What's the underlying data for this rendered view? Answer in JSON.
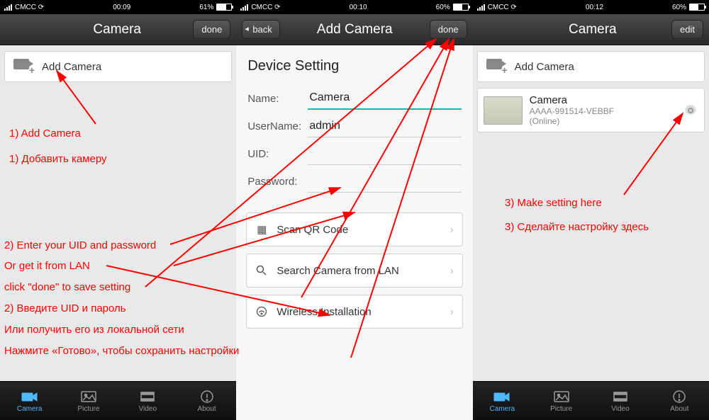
{
  "screen1": {
    "status": {
      "carrier": "CMCC",
      "time": "00:09",
      "battery_pct": "61%",
      "batt_fill": 61
    },
    "nav": {
      "title": "Camera",
      "done": "done"
    },
    "addCamera": {
      "label": "Add Camera"
    },
    "tabs": {
      "camera": "Camera",
      "picture": "Picture",
      "video": "Video",
      "about": "About"
    }
  },
  "screen2": {
    "status": {
      "carrier": "CMCC",
      "time": "00:10",
      "battery_pct": "60%",
      "batt_fill": 60
    },
    "nav": {
      "back": "back",
      "title": "Add Camera",
      "done": "done"
    },
    "section": "Device Setting",
    "fields": {
      "name_label": "Name:",
      "name_value": "Camera",
      "username_label": "UserName:",
      "username_value": "admin",
      "uid_label": "UID:",
      "uid_value": "",
      "password_label": "Password:",
      "password_value": ""
    },
    "options": {
      "scan": "Scan QR Code",
      "search": "Search Camera from LAN",
      "wireless": "Wireless Installation"
    }
  },
  "screen3": {
    "status": {
      "carrier": "CMCC",
      "time": "00:12",
      "battery_pct": "60%",
      "batt_fill": 60
    },
    "nav": {
      "title": "Camera",
      "edit": "edit"
    },
    "addCamera": {
      "label": "Add Camera"
    },
    "item": {
      "name": "Camera",
      "uid": "AAAA-991514-VEBBF",
      "status": "(Online)"
    },
    "tabs": {
      "camera": "Camera",
      "picture": "Picture",
      "video": "Video",
      "about": "About"
    }
  },
  "annotations": {
    "a1_en": "1) Add Camera",
    "a1_ru": "1) Добавить камеру",
    "a2_en": "2) Enter your UID and password",
    "a2_en2": "Or get it from LAN",
    "a2_en3": "click \"done\" to save setting",
    "a2_ru": "2) Введите UID и пароль",
    "a2_ru2": "Или получить его из локальной сети",
    "a2_ru3": "Нажмите «Готово», чтобы сохранить настройки",
    "a3_en": "3) Make setting here",
    "a3_ru": "3) Сделайте настройку здесь"
  }
}
